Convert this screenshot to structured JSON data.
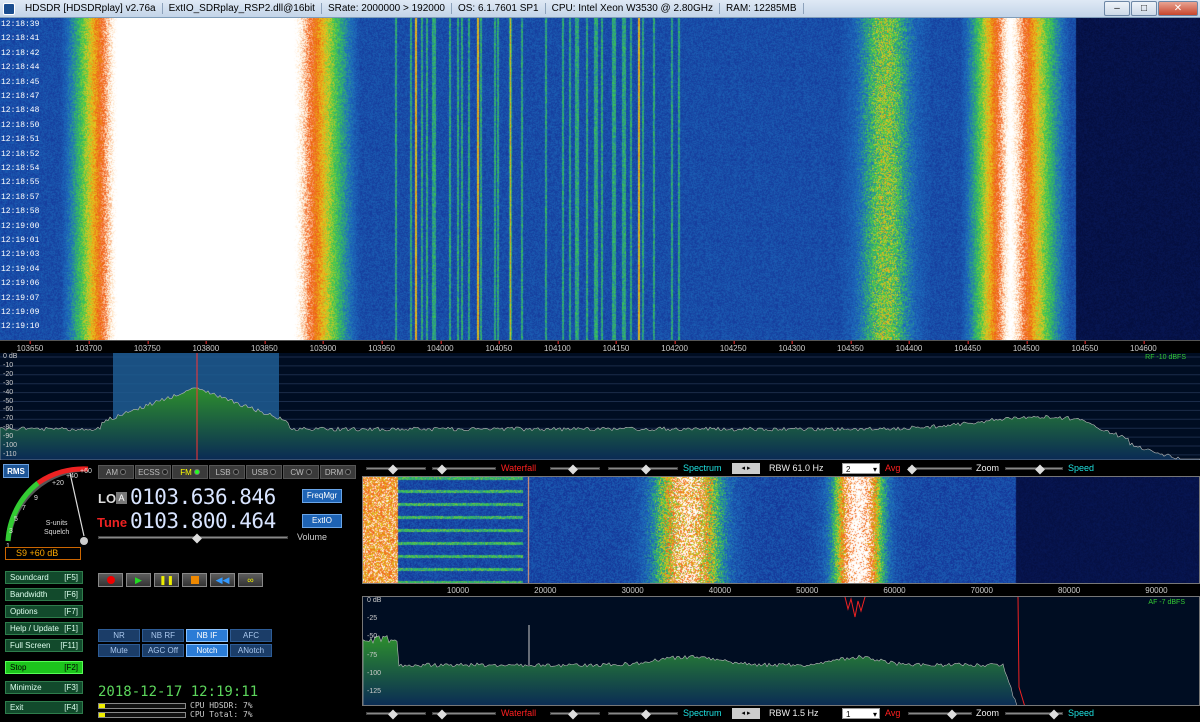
{
  "window": {
    "title_segments": [
      "HDSDR  [HDSDRplay]  v2.76a",
      "ExtIO_SDRplay_RSP2.dll@16bit",
      "SRate: 2000000 > 192000",
      "OS: 6.1.7601 SP1",
      "CPU: Intel Xeon      W3530  @ 2.80GHz",
      "RAM: 12285MB"
    ],
    "controls": {
      "minimize": "–",
      "maximize": "□",
      "close": "✕"
    }
  },
  "main_waterfall": {
    "times": [
      "12:18:39",
      "12:18:41",
      "12:18:42",
      "12:18:44",
      "12:18:45",
      "12:18:47",
      "12:18:48",
      "12:18:50",
      "12:18:51",
      "12:18:52",
      "12:18:54",
      "12:18:55",
      "12:18:57",
      "12:18:58",
      "12:19:00",
      "12:19:01",
      "12:19:03",
      "12:19:04",
      "12:19:06",
      "12:19:07",
      "12:19:09",
      "12:19:10"
    ],
    "freq_ticks": [
      "103650",
      "103700",
      "103750",
      "103800",
      "103850",
      "103900",
      "103950",
      "104000",
      "104050",
      "104100",
      "104150",
      "104200",
      "104250",
      "104300",
      "104350",
      "104400",
      "104450",
      "104500",
      "104550",
      "104600"
    ]
  },
  "main_spectrum": {
    "db_labels": [
      "0 dB",
      "-10",
      "-20",
      "-30",
      "-40",
      "-50",
      "-60",
      "-70",
      "-80",
      "-90",
      "-100",
      "-110"
    ],
    "rf_level": "RF -10 dBFS"
  },
  "meter": {
    "rms": "RMS",
    "scale": [
      "1",
      "3",
      "5",
      "7",
      "9",
      "+20",
      "+40",
      "+60"
    ],
    "s_units": "S-units",
    "squelch": "Squelch",
    "reading": "S9 +60 dB"
  },
  "side_buttons": [
    {
      "label": "Soundcard",
      "key": "[F5]"
    },
    {
      "label": "Bandwidth",
      "key": "[F6]"
    },
    {
      "label": "Options",
      "key": "[F7]"
    },
    {
      "label": "Help / Update",
      "key": "[F1]"
    },
    {
      "label": "Full Screen",
      "key": "[F11]"
    },
    {
      "label": "Stop",
      "key": "[F2]"
    },
    {
      "label": "Minimize",
      "key": "[F3]"
    },
    {
      "label": "Exit",
      "key": "[F4]"
    }
  ],
  "modes": [
    {
      "label": "AM",
      "active": false
    },
    {
      "label": "ECSS",
      "active": false
    },
    {
      "label": "FM",
      "active": true
    },
    {
      "label": "LSB",
      "active": false
    },
    {
      "label": "USB",
      "active": false
    },
    {
      "label": "CW",
      "active": false
    },
    {
      "label": "DRM",
      "active": false
    }
  ],
  "tuning": {
    "lo_label": "LO",
    "lo_vfo": "A",
    "lo_freq": "0103.636.846",
    "tune_label": "Tune",
    "tune_freq": "0103.800.464",
    "freqmgr": "FreqMgr",
    "extio": "ExtIO",
    "volume": "Volume"
  },
  "transport_icons": [
    "record-icon",
    "play-icon",
    "pause-icon",
    "stop-icon",
    "rewind-icon",
    "loop-icon"
  ],
  "dsp": [
    {
      "label": "NR",
      "on": false
    },
    {
      "label": "NB RF",
      "on": false
    },
    {
      "label": "NB IF",
      "on": true
    },
    {
      "label": "AFC",
      "on": false
    },
    {
      "label": "Mute",
      "on": false
    },
    {
      "label": "AGC Off",
      "on": false
    },
    {
      "label": "Notch",
      "on": true
    },
    {
      "label": "ANotch",
      "on": false
    }
  ],
  "status": {
    "datetime": "2018-12-17  12:19:11",
    "cpu_hdsdr": "CPU HDSDR:  7%",
    "cpu_total": "CPU Total:  7%",
    "cpu_hdsdr_pct": 7,
    "cpu_total_pct": 7
  },
  "top_ctrl": {
    "waterfall": "Waterfall",
    "spectrum": "Spectrum",
    "rbw": "RBW 61.0 Hz",
    "avg_value": "2",
    "avg": "Avg",
    "zoom": "Zoom",
    "speed": "Speed"
  },
  "bottom_ctrl": {
    "waterfall": "Waterfall",
    "spectrum": "Spectrum",
    "rbw": "RBW  1.5 Hz",
    "avg_value": "1",
    "avg": "Avg",
    "zoom": "Zoom",
    "speed": "Speed"
  },
  "af": {
    "ticks": [
      "10000",
      "20000",
      "30000",
      "40000",
      "50000",
      "60000",
      "70000",
      "80000",
      "90000"
    ],
    "db_labels": [
      "0 dB",
      "-25",
      "-50",
      "-75",
      "-100",
      "-125"
    ],
    "level": "AF -7 dBFS"
  },
  "colors": {
    "accent_blue": "#1e63b4",
    "cyan_label": "#1ee0e0",
    "red_label": "#ff2020",
    "green_time": "#5cd65c"
  }
}
